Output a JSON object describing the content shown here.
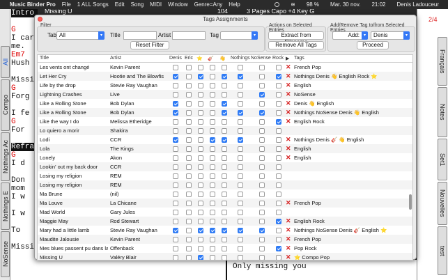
{
  "menubar": {
    "app": "Music Binder Pro",
    "items": [
      "File",
      "1 ALL Songs",
      "Edit",
      "Song",
      "MIDI",
      "Window",
      "Genre=Any",
      "Help"
    ],
    "status": [
      "98 %",
      "Mar. 30 nov.",
      "21:02",
      "Denis Ladouceur"
    ]
  },
  "song": {
    "title": "Missing U",
    "tempo": "104",
    "info": "3 Pages Capo +4 Key G",
    "page": "2/4",
    "lines": [
      {
        "t": "Intro",
        "k": "sec"
      },
      {
        "t": "",
        "k": "n"
      },
      {
        "t": "G",
        "k": "ch"
      },
      {
        "t": "I car",
        "k": "n"
      },
      {
        "t": "me.",
        "k": "n"
      },
      {
        "t": "Em7",
        "k": "ch"
      },
      {
        "t": "Hush",
        "k": "n"
      },
      {
        "t": "",
        "k": "n"
      },
      {
        "t": "Missi",
        "k": "n"
      },
      {
        "t": "G",
        "k": "ch"
      },
      {
        "t": "Forg",
        "k": "n"
      },
      {
        "t": "",
        "k": "n"
      },
      {
        "t": "I fe",
        "k": "n"
      },
      {
        "t": "G",
        "k": "ch"
      },
      {
        "t": "For",
        "k": "n"
      },
      {
        "t": "",
        "k": "n"
      },
      {
        "t": "Refra",
        "k": "sec"
      },
      {
        "t": "G",
        "k": "ch"
      },
      {
        "t": "I d",
        "k": "n"
      },
      {
        "t": "",
        "k": "n"
      },
      {
        "t": "Don",
        "k": "n"
      },
      {
        "t": "mom",
        "k": "n"
      },
      {
        "t": "I w",
        "k": "n"
      },
      {
        "t": "",
        "k": "n"
      },
      {
        "t": "I w",
        "k": "n"
      },
      {
        "t": "",
        "k": "n"
      },
      {
        "t": "To",
        "k": "n"
      },
      {
        "t": "",
        "k": "n"
      },
      {
        "t": "Missing you",
        "k": "n"
      }
    ],
    "bottom_right": "Only missing you"
  },
  "left_tabs": [
    "All",
    "Compo",
    "Nothings Ac",
    "Nothings E",
    "NoSense"
  ],
  "right_tabs": [
    "Français",
    "Notes",
    "Set1",
    "Nouvelles",
    "test"
  ],
  "dialog": {
    "title": "Tags Assignments",
    "filter": {
      "group": "Filter",
      "tab_label": "Tab",
      "tab_value": "All",
      "title_label": "Title",
      "artist_label": "Artist",
      "tag_label": "Tag",
      "reset": "Reset Filter"
    },
    "actions": {
      "group": "Actions on Selected Entries",
      "extract": "Extract from Filename",
      "remove": "Remove All Tags"
    },
    "addremove": {
      "group": "Add/Remove Tag to/from Selected Entries",
      "mode": "Add:",
      "tag": "Denis",
      "proceed": "Proceed"
    },
    "headers": {
      "title": "Title",
      "artist": "Artist",
      "denis": "Denis",
      "eric": "Eric",
      "star": "⭐",
      "guitar": "🎸",
      "hand": "👋",
      "nothings": "Nothings",
      "nosense": "NoSense",
      "rock": "Rock",
      "play": "▶",
      "tags": "Tags"
    },
    "rows": [
      {
        "title": "Les vents ont changé",
        "artist": "Kevin Parent",
        "c": [
          0,
          0,
          0,
          0,
          0,
          0,
          0,
          0
        ],
        "x": true,
        "tags": "French Pop"
      },
      {
        "title": "Let Her Cry",
        "artist": "Hootie and The Blowfis",
        "c": [
          1,
          0,
          1,
          0,
          1,
          1,
          0,
          1
        ],
        "x": true,
        "tags": "Nothings Denis 👋 English Rock ⭐"
      },
      {
        "title": "Life by the drop",
        "artist": "Stevie Ray Vaughan",
        "c": [
          0,
          0,
          0,
          0,
          0,
          0,
          0,
          0
        ],
        "x": true,
        "tags": "English"
      },
      {
        "title": "Lightning Crashes",
        "artist": "Live",
        "c": [
          0,
          0,
          0,
          0,
          0,
          0,
          1,
          0
        ],
        "x": true,
        "tags": "NoSense"
      },
      {
        "title": "Like a Rolling Stone",
        "artist": "Bob Dylan",
        "c": [
          1,
          0,
          0,
          0,
          1,
          0,
          0,
          0
        ],
        "x": true,
        "tags": "Denis 👋 English"
      },
      {
        "title": "Like a Rolling Stone",
        "artist": "Bob Dylan",
        "c": [
          1,
          0,
          0,
          0,
          1,
          1,
          1,
          0
        ],
        "x": true,
        "tags": "Nothings NoSense Denis 👋 English"
      },
      {
        "title": "Like the way I do",
        "artist": "Melissa Etheridge",
        "c": [
          0,
          0,
          0,
          0,
          0,
          0,
          0,
          1
        ],
        "x": true,
        "tags": "English Rock"
      },
      {
        "title": "Lo quiero a morir",
        "artist": "Shakira",
        "c": [
          0,
          0,
          0,
          0,
          0,
          0,
          0,
          0
        ],
        "x": false,
        "tags": ""
      },
      {
        "title": "Lodi",
        "artist": "CCR",
        "c": [
          1,
          0,
          0,
          1,
          1,
          1,
          0,
          0
        ],
        "x": true,
        "tags": "Nothings Denis 🎸 👋 English"
      },
      {
        "title": "Lola",
        "artist": "The Kings",
        "c": [
          0,
          0,
          0,
          0,
          0,
          0,
          0,
          0
        ],
        "x": true,
        "tags": "English"
      },
      {
        "title": "Lonely",
        "artist": "Akon",
        "c": [
          0,
          0,
          0,
          0,
          0,
          0,
          0,
          0
        ],
        "x": true,
        "tags": "English"
      },
      {
        "title": "Lookin' out my back door",
        "artist": "CCR",
        "c": [
          0,
          0,
          0,
          0,
          0,
          0,
          0,
          0
        ],
        "x": false,
        "tags": ""
      },
      {
        "title": "Losing my religion",
        "artist": "REM",
        "c": [
          0,
          0,
          0,
          0,
          0,
          0,
          0,
          0
        ],
        "x": false,
        "tags": ""
      },
      {
        "title": "Losing my religion",
        "artist": "REM",
        "c": [
          0,
          0,
          0,
          0,
          0,
          0,
          0,
          0
        ],
        "x": false,
        "tags": ""
      },
      {
        "title": "Ma Brune",
        "artist": "(nil)",
        "c": [
          0,
          0,
          0,
          0,
          0,
          0,
          0,
          0
        ],
        "x": false,
        "tags": ""
      },
      {
        "title": "Ma Louve",
        "artist": "La Chicane",
        "c": [
          0,
          0,
          0,
          0,
          0,
          0,
          0,
          0
        ],
        "x": true,
        "tags": "French Pop"
      },
      {
        "title": "Mad World",
        "artist": "Gary Jules",
        "c": [
          0,
          0,
          0,
          0,
          0,
          0,
          0,
          0
        ],
        "x": false,
        "tags": ""
      },
      {
        "title": "Maggie May",
        "artist": "Rod Stewart",
        "c": [
          0,
          0,
          0,
          0,
          0,
          0,
          0,
          1
        ],
        "x": true,
        "tags": "English Rock"
      },
      {
        "title": "Mary had a little lamb",
        "artist": "Stevie Ray Vaughan",
        "c": [
          1,
          0,
          1,
          1,
          1,
          1,
          1,
          0
        ],
        "x": true,
        "tags": "Nothings NoSense Denis 🎸 English ⭐"
      },
      {
        "title": "Maudite Jalousie",
        "artist": "Kevin Parent",
        "c": [
          0,
          0,
          0,
          0,
          0,
          0,
          0,
          0
        ],
        "x": true,
        "tags": "French Pop"
      },
      {
        "title": "Mes blues passent pu dans la po",
        "artist": "Offenback",
        "c": [
          0,
          0,
          0,
          0,
          0,
          0,
          0,
          1
        ],
        "x": true,
        "tags": "Pop Rock"
      },
      {
        "title": "Missing U",
        "artist": "Valéry Blair",
        "c": [
          0,
          0,
          1,
          0,
          0,
          0,
          0,
          0
        ],
        "x": true,
        "tags": "⭐ Compo Pop"
      }
    ]
  }
}
